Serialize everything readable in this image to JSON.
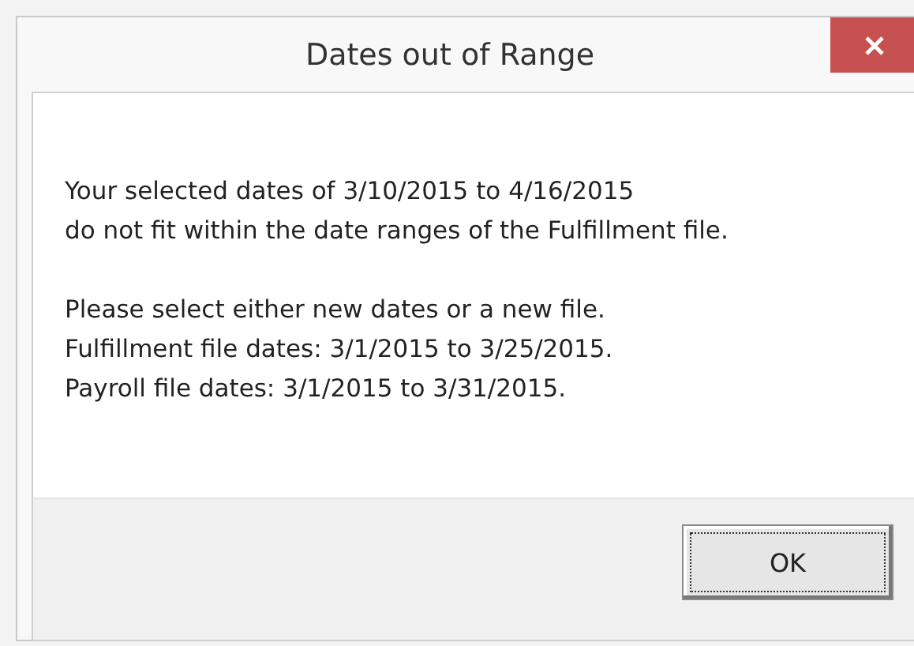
{
  "window": {
    "title": "Dates out of Range"
  },
  "message": [
    [
      "Your selected dates of 3/10/2015 to 4/16/2015",
      "do not fit within the date ranges of the Fulfillment file."
    ],
    [
      "Please select either new dates or a new file.",
      "Fulfillment file dates: 3/1/2015 to 3/25/2015.",
      "Payroll file dates: 3/1/2015 to 3/31/2015."
    ]
  ],
  "buttons": [
    {
      "label": "OK",
      "focused": true
    }
  ]
}
